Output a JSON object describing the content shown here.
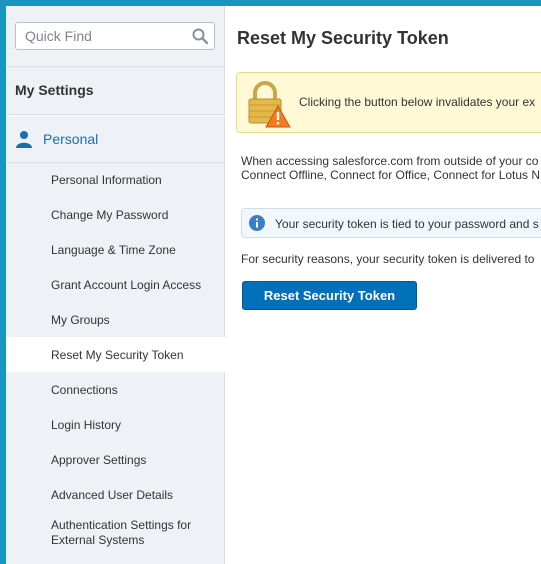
{
  "sidebar": {
    "search": {
      "placeholder": "Quick Find",
      "value": ""
    },
    "section_title": "My Settings",
    "personal_label": "Personal",
    "items": [
      {
        "label": "Personal Information",
        "active": false
      },
      {
        "label": "Change My Password",
        "active": false
      },
      {
        "label": "Language & Time Zone",
        "active": false
      },
      {
        "label": "Grant Account Login Access",
        "active": false
      },
      {
        "label": "My Groups",
        "active": false
      },
      {
        "label": "Reset My Security Token",
        "active": true
      },
      {
        "label": "Connections",
        "active": false
      },
      {
        "label": "Login History",
        "active": false
      },
      {
        "label": "Approver Settings",
        "active": false
      },
      {
        "label": "Advanced User Details",
        "active": false
      },
      {
        "label": "Authentication Settings for External Systems",
        "active": false
      }
    ]
  },
  "main": {
    "title": "Reset My Security Token",
    "warning": "Clicking the button below invalidates your ex",
    "body_line1": "When accessing salesforce.com from outside of your co",
    "body_line2": "Connect Offline, Connect for Office, Connect for Lotus N",
    "info": "Your security token is tied to your password and s",
    "reason": "For security reasons, your security token is delivered to",
    "reset_button": "Reset Security Token"
  },
  "colors": {
    "frame_border": "#1797c0",
    "link_blue": "#1a6fb0",
    "button_blue": "#0070b8",
    "warning_bg": "#fff9d6",
    "info_bg": "#f2f7fc"
  },
  "icons": {
    "search": "search-icon",
    "personal": "person-icon",
    "warning": "lock-warning-icon",
    "info": "info-icon"
  }
}
